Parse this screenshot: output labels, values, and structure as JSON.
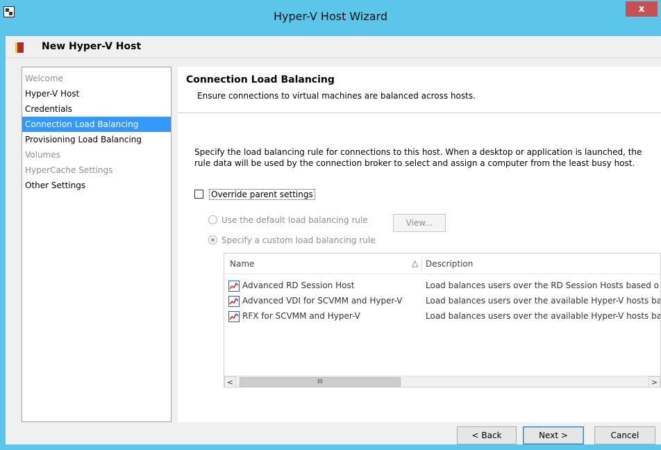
{
  "window": {
    "title": "Hyper-V Host Wizard",
    "close_label": "x"
  },
  "header": {
    "title": "New Hyper-V Host"
  },
  "sidebar": {
    "items": [
      {
        "label": "Welcome",
        "state": "disabled"
      },
      {
        "label": "Hyper-V Host",
        "state": "normal"
      },
      {
        "label": "Credentials",
        "state": "normal"
      },
      {
        "label": "Connection Load Balancing",
        "state": "selected"
      },
      {
        "label": "Provisioning Load Balancing",
        "state": "normal"
      },
      {
        "label": "Volumes",
        "state": "disabled"
      },
      {
        "label": "HyperCache Settings",
        "state": "disabled"
      },
      {
        "label": "Other Settings",
        "state": "normal"
      }
    ]
  },
  "content": {
    "title": "Connection Load Balancing",
    "subtitle": "Ensure connections to virtual machines are balanced across hosts.",
    "description": "Specify the load balancing rule for connections to this host.  When a desktop or application is launched, the rule data will be used by the connection broker to select and assign a computer from the least busy host.",
    "override_label": "Override parent settings",
    "override_checked": false,
    "radio_default_label": "Use the default load balancing rule",
    "radio_custom_label": "Specify a custom load balancing rule",
    "radio_selected": "custom",
    "view_button": "View...",
    "list": {
      "columns": [
        "Name",
        "Description"
      ],
      "sort_arrow": "△",
      "rows": [
        {
          "name": "Advanced RD Session Host",
          "description": "Load balances users over the RD Session Hosts based o"
        },
        {
          "name": "Advanced VDI for SCVMM and Hyper-V",
          "description": "Load balances users over the available Hyper-V hosts ba"
        },
        {
          "name": "RFX for SCVMM and Hyper-V",
          "description": "Load balances users over the available Hyper-V hosts ba"
        }
      ]
    },
    "scrollbar": {
      "left_arrow": "<",
      "right_arrow": ">",
      "thumb_grip": "III"
    }
  },
  "footer": {
    "back_label": "< Back",
    "next_label": "Next >",
    "cancel_label": "Cancel"
  },
  "colors": {
    "titlebar": "#5bc6e9",
    "selection": "#3399ff",
    "close": "#c75050"
  }
}
